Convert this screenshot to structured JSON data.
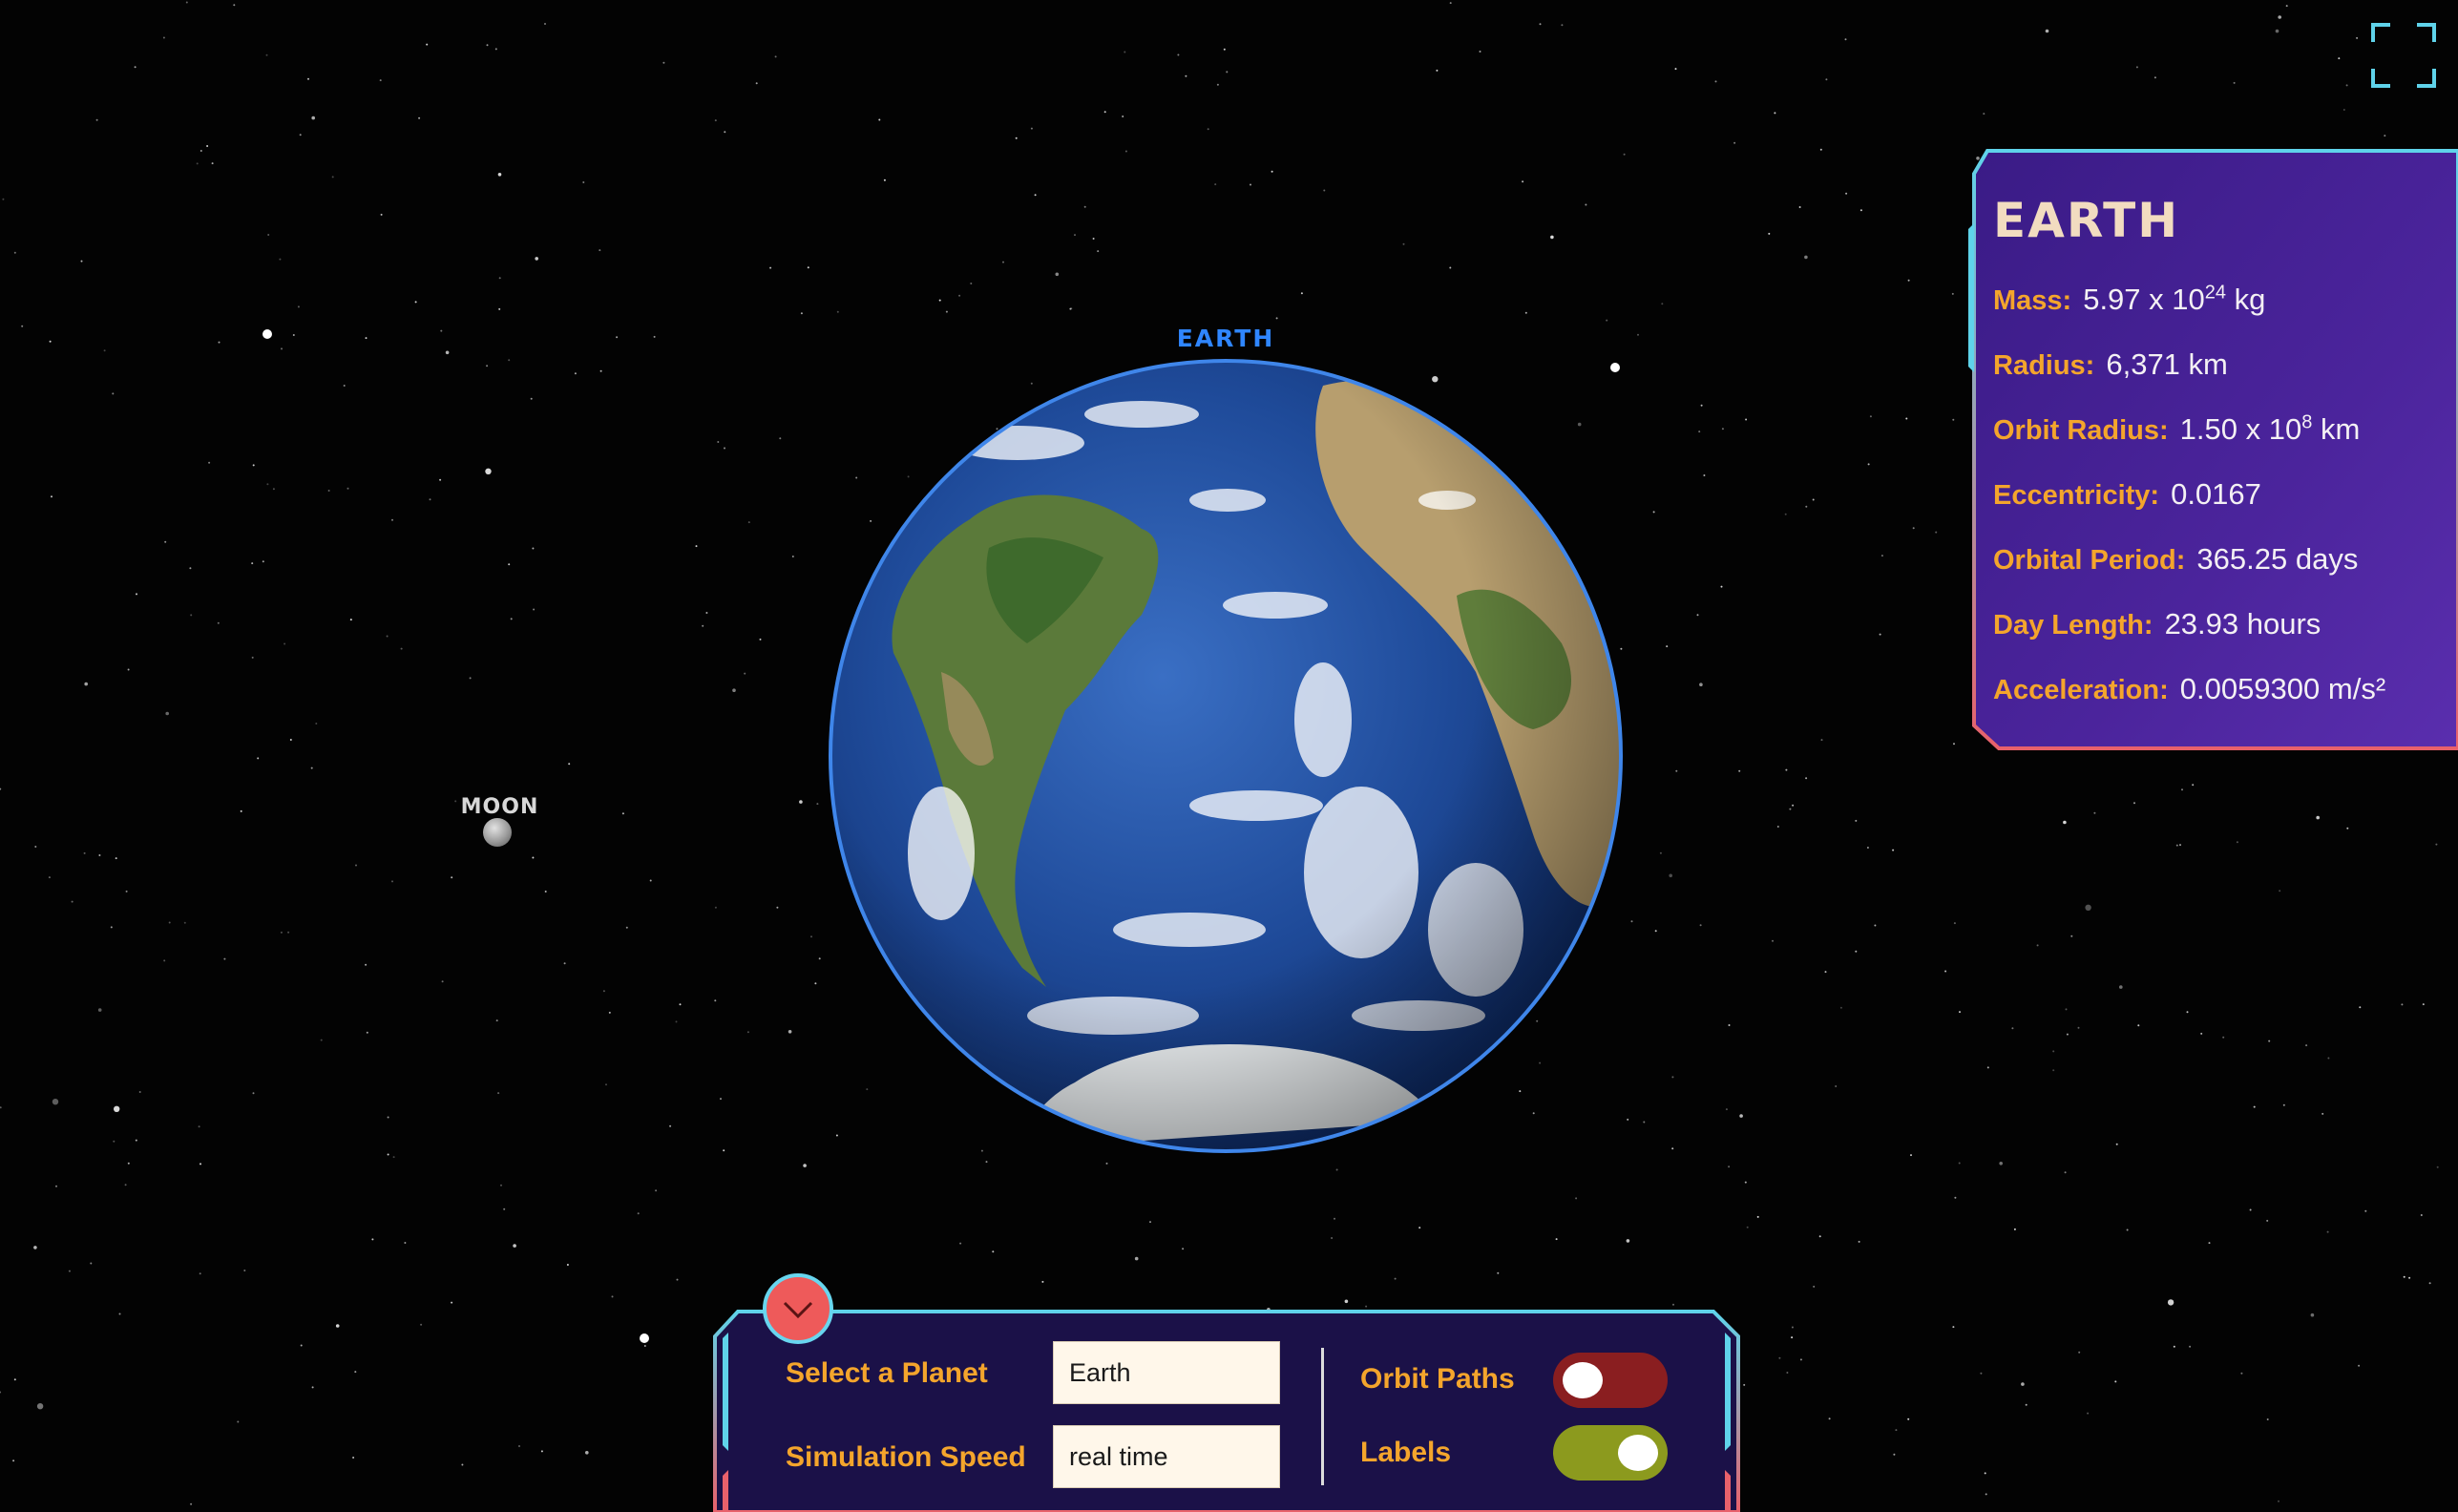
{
  "scene": {
    "planet_label": "EARTH",
    "moon_label": "MOON"
  },
  "info": {
    "title": "EARTH",
    "mass": {
      "label": "Mass:",
      "mantissa": "5.97 x 10",
      "exponent": "24",
      "unit": "kg"
    },
    "radius": {
      "label": "Radius:",
      "value": "6,371 km"
    },
    "orbit_radius": {
      "label": "Orbit Radius:",
      "mantissa": "1.50 x 10",
      "exponent": "8",
      "unit": "km"
    },
    "eccentricity": {
      "label": "Eccentricity:",
      "value": "0.0167"
    },
    "orbital_period": {
      "label": "Orbital Period:",
      "value": "365.25 days"
    },
    "day_length": {
      "label": "Day Length:",
      "value": "23.93 hours"
    },
    "acceleration": {
      "label": "Acceleration:",
      "value": "0.0059300 m/s²"
    }
  },
  "controls": {
    "select_planet_label": "Select a Planet",
    "select_planet_value": "Earth",
    "sim_speed_label": "Simulation Speed",
    "sim_speed_value": "real time",
    "orbit_paths_label": "Orbit Paths",
    "orbit_paths_on": false,
    "labels_label": "Labels",
    "labels_on": true
  },
  "colors": {
    "accent_orange": "#f4a52c",
    "panel_purple": "#4a2196",
    "frame_cyan": "#5fd3ea",
    "frame_red": "#e8616b",
    "earth_label_blue": "#2f86ff",
    "switch_off": "#8a1e20",
    "switch_on": "#8c9a1e"
  },
  "icons": {
    "fullscreen": "fullscreen-icon",
    "collapse": "chevron-down-icon"
  }
}
